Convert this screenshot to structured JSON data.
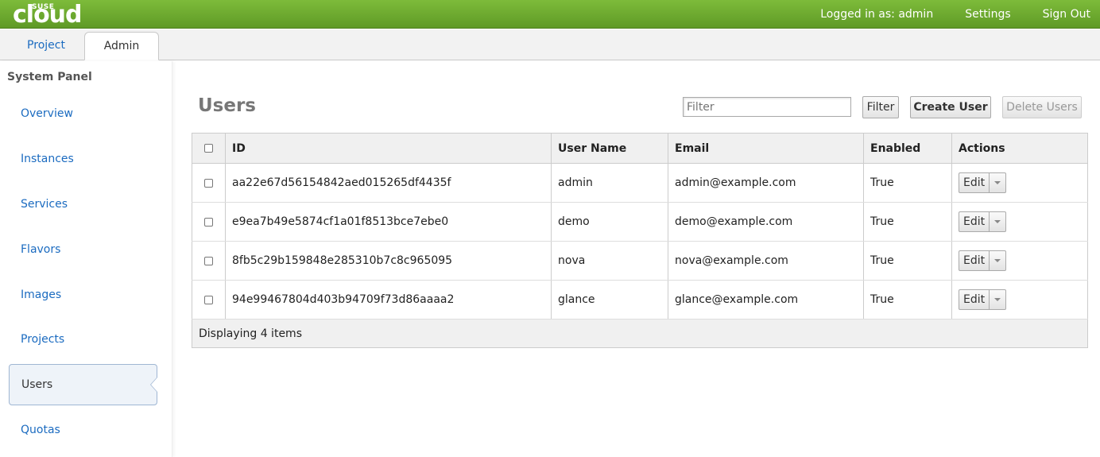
{
  "brand": {
    "top": "SUSE",
    "main": "cloud"
  },
  "header": {
    "logged_in": "Logged in as: admin",
    "settings": "Settings",
    "sign_out": "Sign Out"
  },
  "tabs": [
    {
      "label": "Project"
    },
    {
      "label": "Admin"
    }
  ],
  "sidebar": {
    "title": "System Panel",
    "items": [
      {
        "label": "Overview"
      },
      {
        "label": "Instances"
      },
      {
        "label": "Services"
      },
      {
        "label": "Flavors"
      },
      {
        "label": "Images"
      },
      {
        "label": "Projects"
      },
      {
        "label": "Users"
      },
      {
        "label": "Quotas"
      }
    ]
  },
  "main": {
    "title": "Users",
    "filter_placeholder": "Filter",
    "filter_button": "Filter",
    "create_button": "Create User",
    "delete_button": "Delete Users",
    "columns": [
      "ID",
      "User Name",
      "Email",
      "Enabled",
      "Actions"
    ],
    "rows": [
      {
        "id": "aa22e67d56154842aed015265df4435f",
        "name": "admin",
        "email": "admin@example.com",
        "enabled": "True",
        "action": "Edit"
      },
      {
        "id": "e9ea7b49e5874cf1a01f8513bce7ebe0",
        "name": "demo",
        "email": "demo@example.com",
        "enabled": "True",
        "action": "Edit"
      },
      {
        "id": "8fb5c29b159848e285310b7c8c965095",
        "name": "nova",
        "email": "nova@example.com",
        "enabled": "True",
        "action": "Edit"
      },
      {
        "id": "94e99467804d403b94709f73d86aaaa2",
        "name": "glance",
        "email": "glance@example.com",
        "enabled": "True",
        "action": "Edit"
      }
    ],
    "footer": "Displaying 4 items"
  },
  "colors": {
    "brand_green": "#6aab2e",
    "link_blue": "#1b6bc0"
  }
}
